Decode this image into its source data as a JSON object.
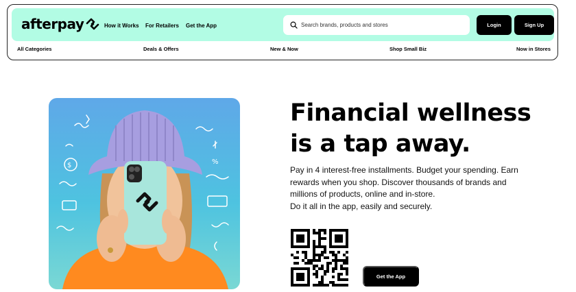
{
  "header": {
    "logo_text": "afterpay",
    "nav": [
      "How it Works",
      "For Retailers",
      "Get the App"
    ],
    "search": {
      "placeholder": "Search brands, products and stores",
      "icon": "search-icon"
    },
    "login_label": "Login",
    "signup_label": "Sign Up",
    "brand_color": "#b2fce4"
  },
  "categories": [
    "All Categories",
    "Deals & Offers",
    "New & Now",
    "Shop Small Biz",
    "Now in Stores"
  ],
  "hero": {
    "headline_line1": "Financial wellness",
    "headline_line2": "is a tap away.",
    "body_line1": "Pay in 4 interest-free installments. Budget your spending. Earn",
    "body_line2": "rewards when you shop. Discover thousands of brands and",
    "body_line3": "millions of products, online and in-store.",
    "body_line4": "Do it all in the app, easily and securely.",
    "cta_label": "Get the App"
  }
}
